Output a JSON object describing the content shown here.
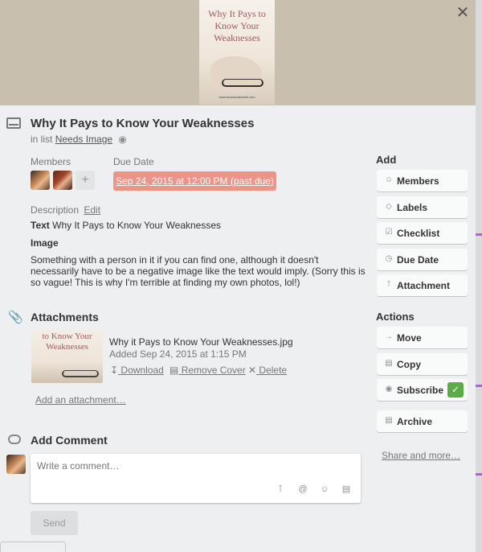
{
  "cover": {
    "image_title": "Why It Pays to Know Your Weaknesses",
    "image_url_text": "www.ilovesmakewell.com"
  },
  "close_label": "✕",
  "card": {
    "title": "Why It Pays to Know Your Weaknesses",
    "in_list_prefix": "in list",
    "list_name": "Needs Image"
  },
  "members": {
    "label": "Members",
    "add_label": "+"
  },
  "due_date": {
    "label": "Due Date",
    "value": "Sep 24, 2015 at 12:00 PM (past due)",
    "color": "#ec9488"
  },
  "description": {
    "label": "Description",
    "edit_label": "Edit",
    "text_label": "Text",
    "text_value": "Why It Pays to Know Your Weaknesses",
    "image_heading": "Image",
    "paragraph": "Something with a person in it if you can find one, although it doesn't necessarily have to be a negative image like the text would imply. (Sorry this is so vague! This is why I'm terrible at finding my own photos, lol!)"
  },
  "attachments": {
    "heading": "Attachments",
    "thumb_text": "to Know Your Weaknesses",
    "file_name": "Why it Pays to Know Your Weaknesses.jpg",
    "added": "Added Sep 24, 2015 at 1:15 PM",
    "download_label": "Download",
    "remove_cover_label": "Remove Cover",
    "delete_label": "Delete",
    "add_label": "Add an attachment…"
  },
  "comment": {
    "heading": "Add Comment",
    "placeholder": "Write a comment…",
    "send_label": "Send"
  },
  "sidebar": {
    "add_heading": "Add",
    "add_items": [
      {
        "label": "Members",
        "icon": "person-icon"
      },
      {
        "label": "Labels",
        "icon": "tag-icon"
      },
      {
        "label": "Checklist",
        "icon": "checkbox-icon"
      },
      {
        "label": "Due Date",
        "icon": "clock-icon"
      },
      {
        "label": "Attachment",
        "icon": "paperclip-icon"
      }
    ],
    "actions_heading": "Actions",
    "action_items": [
      {
        "label": "Move",
        "icon": "arrow-right-icon"
      },
      {
        "label": "Copy",
        "icon": "card-icon"
      },
      {
        "label": "Subscribe",
        "icon": "eye-icon",
        "checked": true
      },
      {
        "label": "Archive",
        "icon": "archive-icon"
      }
    ],
    "share_label": "Share and more…",
    "subscribe_check_color": "#5aac44"
  }
}
